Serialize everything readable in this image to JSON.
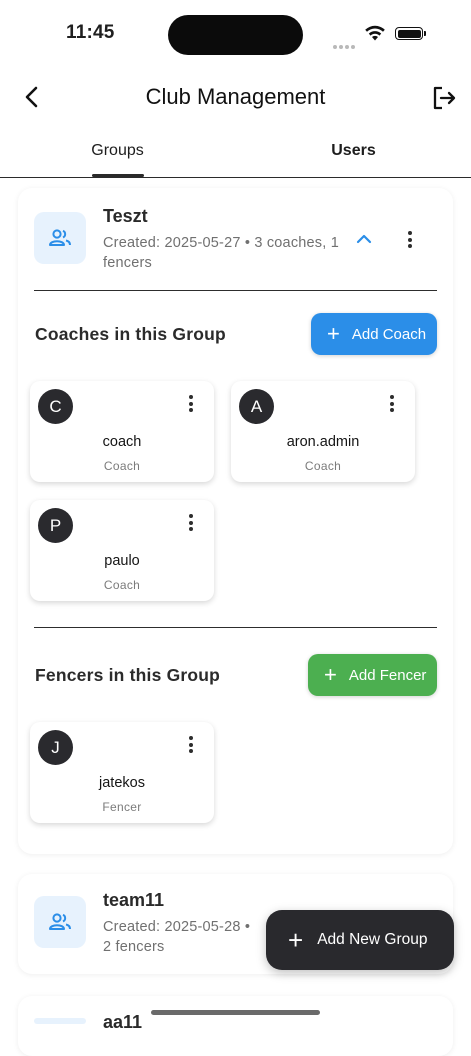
{
  "status_bar": {
    "time": "11:45"
  },
  "app_bar": {
    "title": "Club Management"
  },
  "tabs": [
    {
      "label": "Groups"
    },
    {
      "label": "Users"
    }
  ],
  "groups": [
    {
      "name": "Teszt",
      "meta_line1": "Created: 2025-05-27 • 3 coaches, 1",
      "meta_line2": "fencers",
      "coaches_section": {
        "title": "Coaches in this Group",
        "add_label": "Add Coach",
        "members": [
          {
            "initial": "C",
            "name": "coach",
            "role": "Coach"
          },
          {
            "initial": "A",
            "name": "aron.admin",
            "role": "Coach"
          },
          {
            "initial": "P",
            "name": "paulo",
            "role": "Coach"
          }
        ]
      },
      "fencers_section": {
        "title": "Fencers in this Group",
        "add_label": "Add Fencer",
        "members": [
          {
            "initial": "J",
            "name": "jatekos",
            "role": "Fencer"
          }
        ]
      }
    },
    {
      "name": "team11",
      "meta_line1": "Created: 2025-05-28 •",
      "meta_line2": "2 fencers"
    },
    {
      "name": "aa11"
    }
  ],
  "fab": {
    "label": "Add New Group"
  },
  "colors": {
    "primary_blue": "#2b8ee8",
    "fencer_green": "#4caf50",
    "icon_bg": "#e7f2fd",
    "fab_bg": "#29292d"
  },
  "icons": [
    "back-arrow-icon",
    "logout-icon",
    "group-people-icon",
    "chevron-up-icon",
    "kebab-menu-icon",
    "plus-icon",
    "wifi-icon",
    "battery-icon"
  ]
}
